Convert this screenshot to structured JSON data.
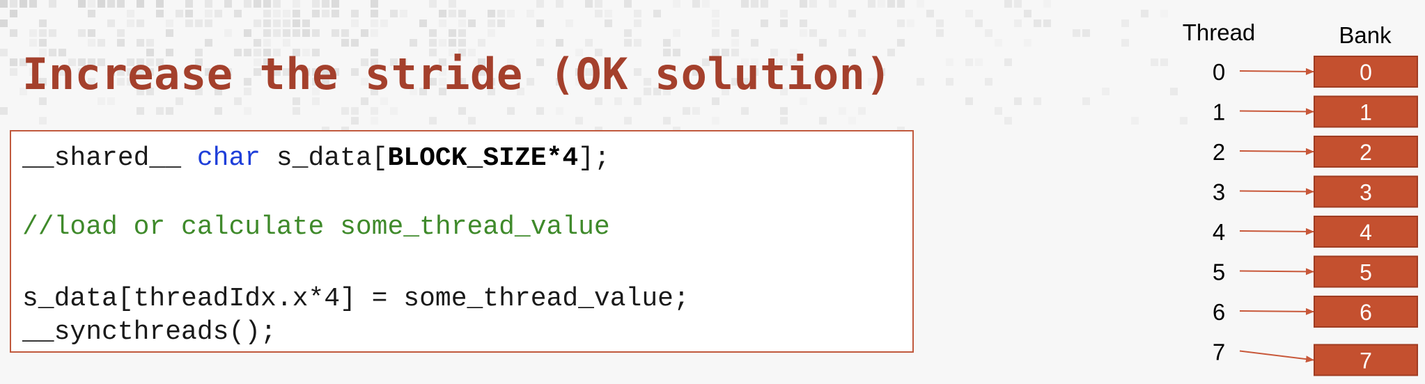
{
  "slide": {
    "title": "Increase the stride (OK solution)"
  },
  "code": {
    "line1": {
      "prefix": "__shared__ ",
      "keyword": "char",
      "middle": " s_data[",
      "bold": "BLOCK_SIZE*4",
      "suffix": "];"
    },
    "comment": "//load or calculate some_thread_value",
    "line3": "s_data[threadIdx.x*4] = some_thread_value;",
    "line4": "__syncthreads();"
  },
  "diagram": {
    "thread_header": "Thread",
    "bank_header": "Bank",
    "threads": [
      "0",
      "1",
      "2",
      "3",
      "4",
      "5",
      "6",
      "7"
    ],
    "banks": [
      "0",
      "1",
      "2",
      "3",
      "4",
      "5",
      "6",
      "7"
    ],
    "colors": {
      "bank_fill": "#c4502f",
      "bank_stroke": "#a03c22",
      "arrow": "#c8583a",
      "title": "#a4402c",
      "keyword": "#1f3fd9",
      "comment": "#3f8a2b"
    }
  }
}
